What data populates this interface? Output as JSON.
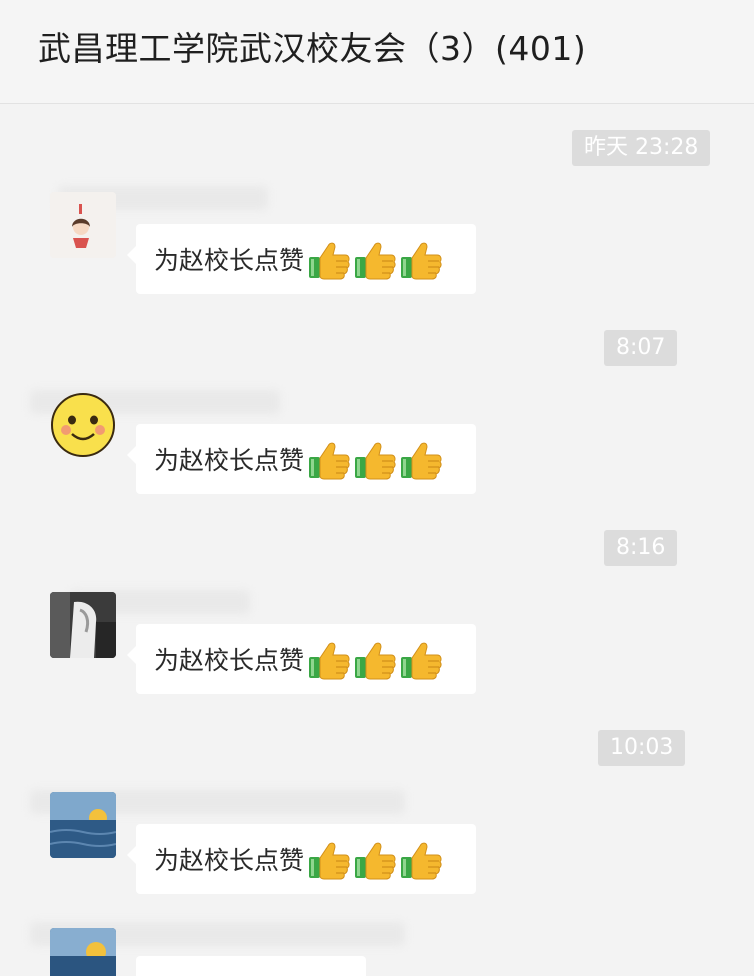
{
  "chat": {
    "title": "武昌理工学院武汉校友会（3）(401)"
  },
  "messages": [
    {
      "timestamp": "昨天 23:28",
      "sender": "",
      "avatar": "cartoon-girl-avatar",
      "text": "为赵校长点赞",
      "emoji": [
        "thumbs-up-icon",
        "thumbs-up-icon",
        "thumbs-up-icon"
      ]
    },
    {
      "timestamp": "8:07",
      "sender": "",
      "avatar": "smiley-face-avatar",
      "text": "为赵校长点赞",
      "emoji": [
        "thumbs-up-icon",
        "thumbs-up-icon",
        "thumbs-up-icon"
      ]
    },
    {
      "timestamp": "8:16",
      "sender": "",
      "avatar": "photo-avatar",
      "text": "为赵校长点赞",
      "emoji": [
        "thumbs-up-icon",
        "thumbs-up-icon",
        "thumbs-up-icon"
      ]
    },
    {
      "timestamp": "10:03",
      "sender": "",
      "avatar": "sea-landscape-avatar",
      "text": "为赵校长点赞",
      "emoji": [
        "thumbs-up-icon",
        "thumbs-up-icon",
        "thumbs-up-icon"
      ]
    },
    {
      "timestamp": "",
      "sender": "",
      "avatar": "sea-sunset-avatar",
      "text": "",
      "emoji": []
    }
  ],
  "colors": {
    "background": "#f3f3f3",
    "bubble": "#ffffff",
    "timestamp_bg": "#dcdcdc",
    "timestamp_text": "#ffffff",
    "thumb_yellow": "#f5b82e",
    "thumb_sleeve": "#3aa745"
  }
}
